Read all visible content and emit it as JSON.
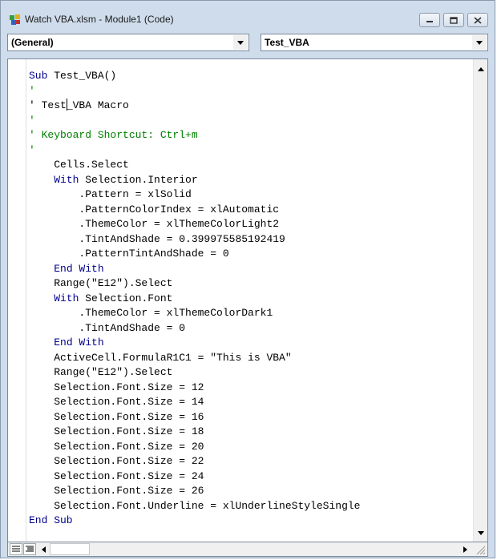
{
  "window": {
    "title": "Watch VBA.xlsm - Module1 (Code)",
    "buttons": [
      "minimize-icon",
      "maximize-icon",
      "close-icon"
    ]
  },
  "dropdowns": {
    "object": "(General)",
    "procedure": "Test_VBA"
  },
  "code": {
    "lines": [
      {
        "segs": [
          {
            "t": "Sub ",
            "c": "kw"
          },
          {
            "t": "Test_VBA()",
            "c": ""
          }
        ]
      },
      {
        "segs": [
          {
            "t": "'",
            "c": "cm"
          }
        ]
      },
      {
        "segs": [
          {
            "t": "' Test",
            "c": ""
          },
          {
            "t": "|cursor|",
            "c": "cursor"
          },
          {
            "t": "_VBA Macro",
            "c": ""
          }
        ]
      },
      {
        "segs": [
          {
            "t": "'",
            "c": "cm"
          }
        ]
      },
      {
        "segs": [
          {
            "t": "' Keyboard Shortcut: Ctrl+m",
            "c": "cm"
          }
        ]
      },
      {
        "segs": [
          {
            "t": "'",
            "c": "cm"
          }
        ]
      },
      {
        "segs": [
          {
            "t": "    Cells.Select",
            "c": ""
          }
        ]
      },
      {
        "segs": [
          {
            "t": "    ",
            "c": ""
          },
          {
            "t": "With ",
            "c": "kw"
          },
          {
            "t": "Selection.Interior",
            "c": ""
          }
        ]
      },
      {
        "segs": [
          {
            "t": "        .Pattern = xlSolid",
            "c": ""
          }
        ]
      },
      {
        "segs": [
          {
            "t": "        .PatternColorIndex = xlAutomatic",
            "c": ""
          }
        ]
      },
      {
        "segs": [
          {
            "t": "        .ThemeColor = xlThemeColorLight2",
            "c": ""
          }
        ]
      },
      {
        "segs": [
          {
            "t": "        .TintAndShade = 0.399975585192419",
            "c": ""
          }
        ]
      },
      {
        "segs": [
          {
            "t": "        .PatternTintAndShade = 0",
            "c": ""
          }
        ]
      },
      {
        "segs": [
          {
            "t": "    ",
            "c": ""
          },
          {
            "t": "End With",
            "c": "kw"
          }
        ]
      },
      {
        "segs": [
          {
            "t": "    Range(\"E12\").Select",
            "c": ""
          }
        ]
      },
      {
        "segs": [
          {
            "t": "    ",
            "c": ""
          },
          {
            "t": "With ",
            "c": "kw"
          },
          {
            "t": "Selection.Font",
            "c": ""
          }
        ]
      },
      {
        "segs": [
          {
            "t": "        .ThemeColor = xlThemeColorDark1",
            "c": ""
          }
        ]
      },
      {
        "segs": [
          {
            "t": "        .TintAndShade = 0",
            "c": ""
          }
        ]
      },
      {
        "segs": [
          {
            "t": "    ",
            "c": ""
          },
          {
            "t": "End With",
            "c": "kw"
          }
        ]
      },
      {
        "segs": [
          {
            "t": "    ActiveCell.FormulaR1C1 = \"This is VBA\"",
            "c": ""
          }
        ]
      },
      {
        "segs": [
          {
            "t": "    Range(\"E12\").Select",
            "c": ""
          }
        ]
      },
      {
        "segs": [
          {
            "t": "    Selection.Font.Size = 12",
            "c": ""
          }
        ]
      },
      {
        "segs": [
          {
            "t": "    Selection.Font.Size = 14",
            "c": ""
          }
        ]
      },
      {
        "segs": [
          {
            "t": "    Selection.Font.Size = 16",
            "c": ""
          }
        ]
      },
      {
        "segs": [
          {
            "t": "    Selection.Font.Size = 18",
            "c": ""
          }
        ]
      },
      {
        "segs": [
          {
            "t": "    Selection.Font.Size = 20",
            "c": ""
          }
        ]
      },
      {
        "segs": [
          {
            "t": "    Selection.Font.Size = 22",
            "c": ""
          }
        ]
      },
      {
        "segs": [
          {
            "t": "    Selection.Font.Size = 24",
            "c": ""
          }
        ]
      },
      {
        "segs": [
          {
            "t": "    Selection.Font.Size = 26",
            "c": ""
          }
        ]
      },
      {
        "segs": [
          {
            "t": "    Selection.Font.Underline = xlUnderlineStyleSingle",
            "c": ""
          }
        ]
      },
      {
        "segs": [
          {
            "t": "End Sub",
            "c": "kw"
          }
        ]
      }
    ]
  },
  "colors": {
    "keyword": "#00008b",
    "comment": "#008000",
    "text": "#000000"
  }
}
